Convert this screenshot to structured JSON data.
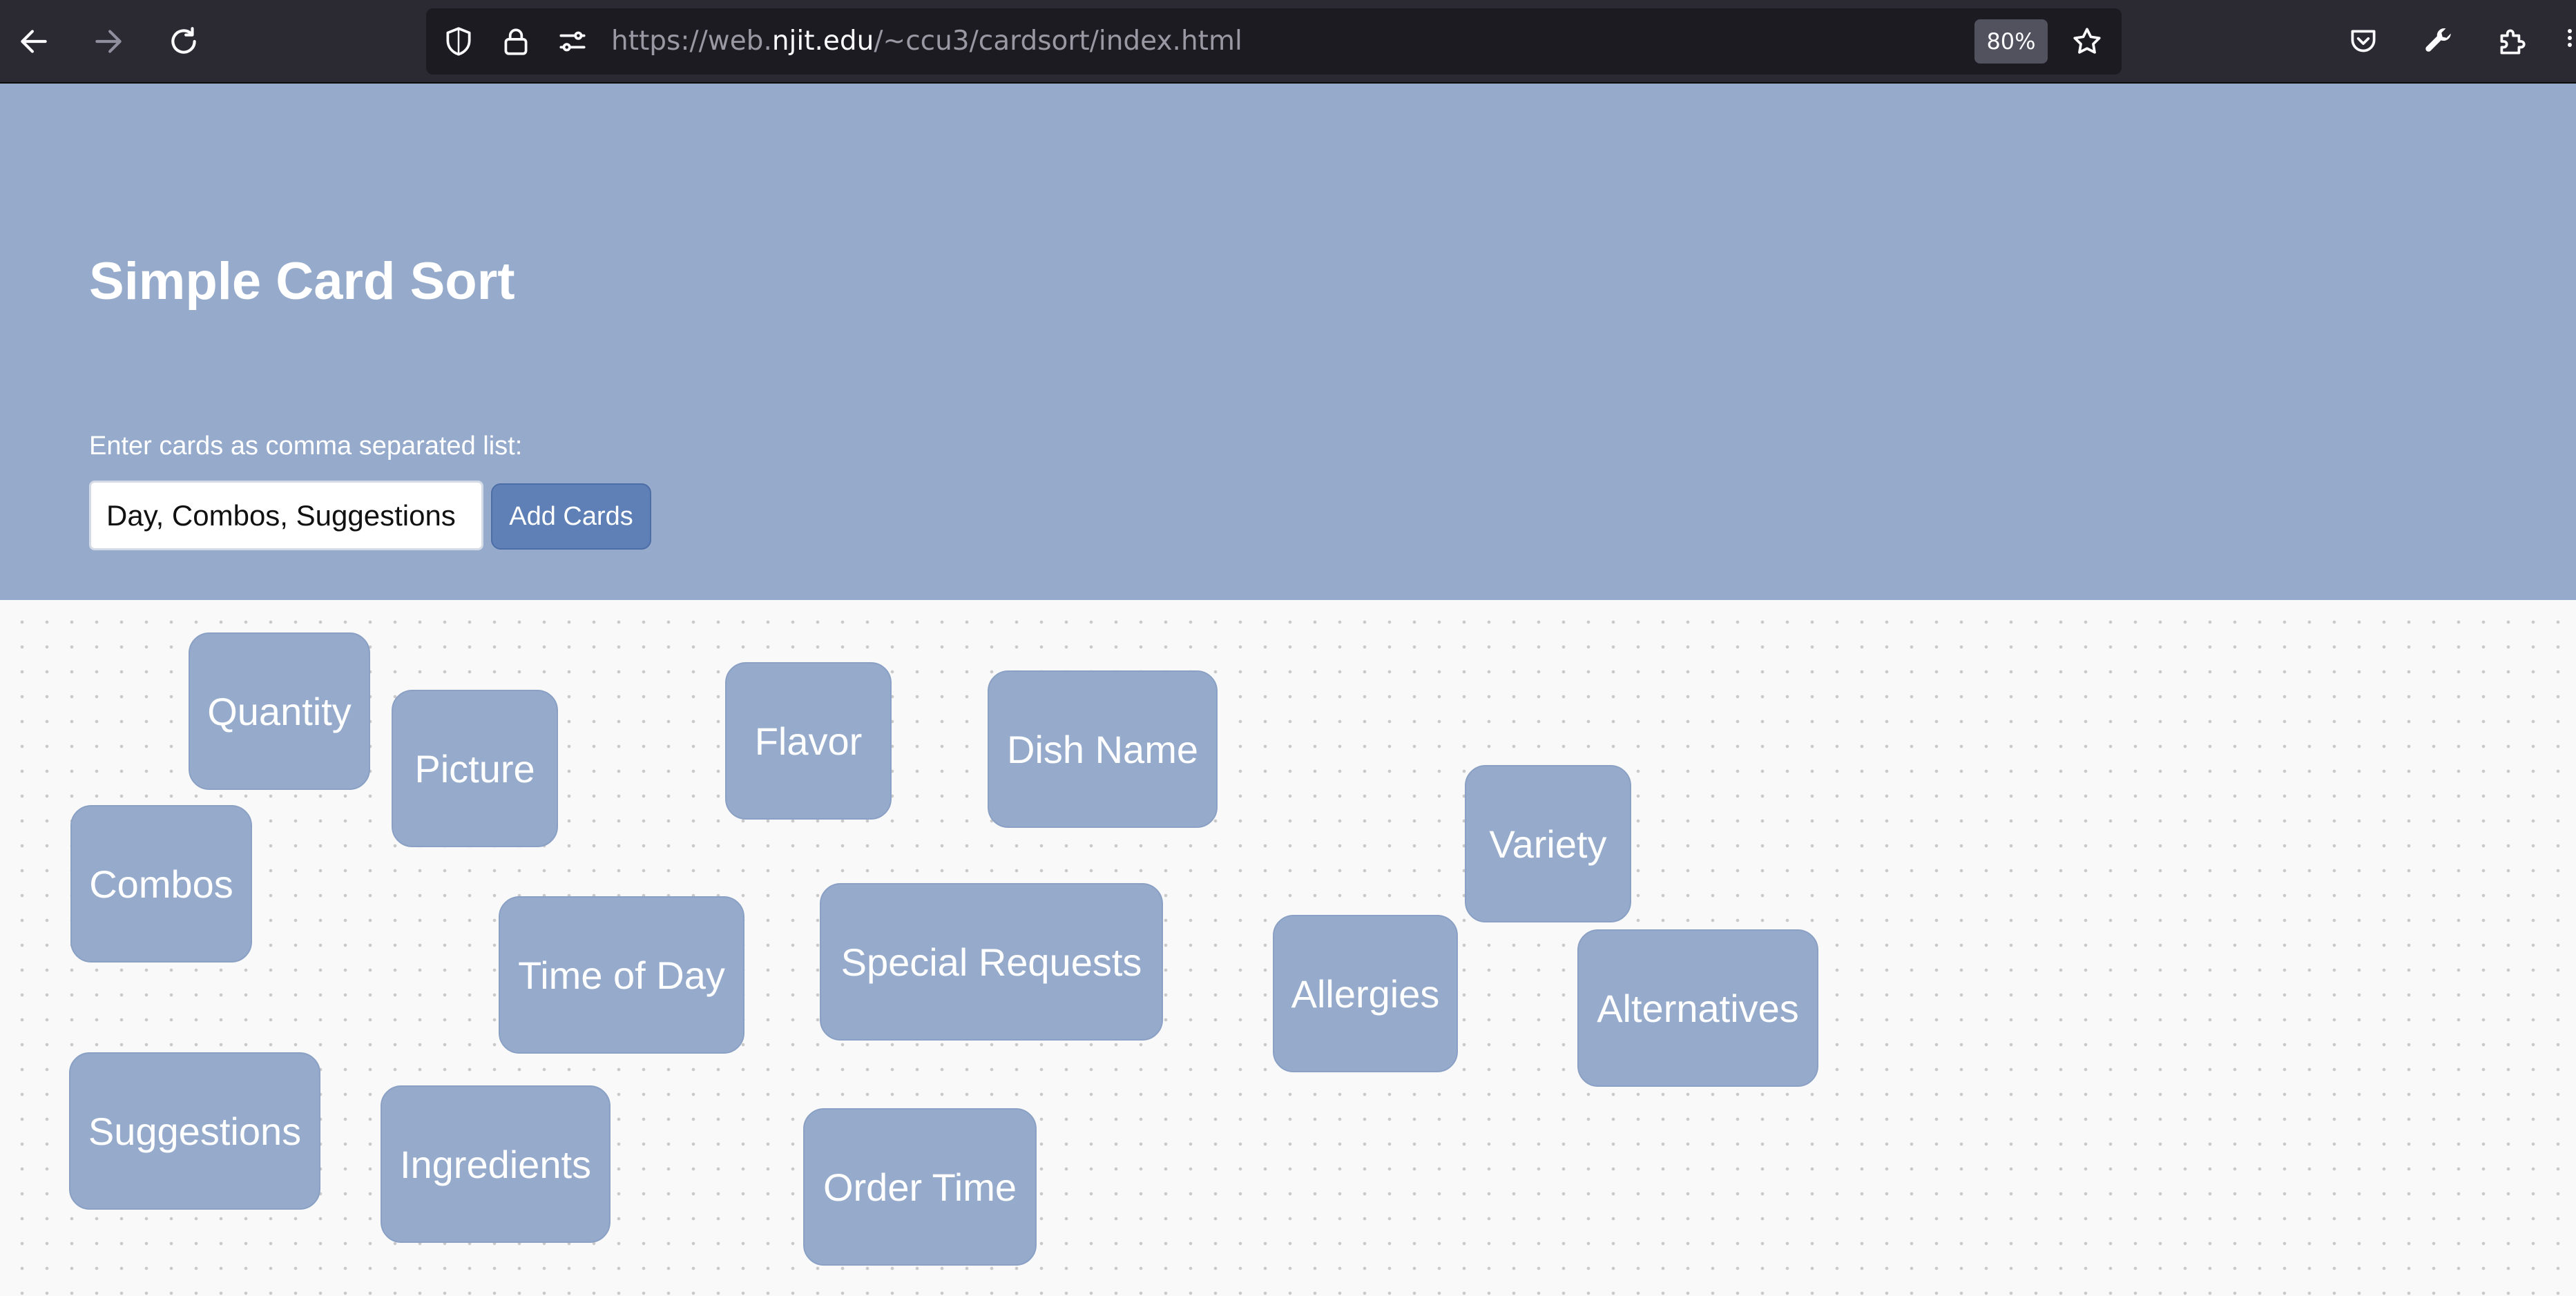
{
  "browser": {
    "url_prefix": "https://web.",
    "url_domain": "njit.edu",
    "url_path": "/~ccu3/cardsort/index.html",
    "zoom": "80%",
    "icons": {
      "back": "arrow-left-icon",
      "forward": "arrow-right-icon",
      "reload": "reload-icon",
      "tracking": "shield-icon",
      "lock": "lock-icon",
      "permissions": "permissions-icon",
      "bookmark": "star-icon",
      "pocket": "pocket-icon",
      "tools": "wrench-icon",
      "extensions": "puzzle-icon"
    },
    "colors": {
      "toolbar": "#2b2a33",
      "urlbar": "#1c1b22"
    }
  },
  "page": {
    "title": "Simple Card Sort",
    "label": "Enter cards as comma separated list:",
    "input_value": "Day, Combos, Suggestions",
    "add_button": "Add Cards",
    "colors": {
      "header": "#96abcc",
      "button": "#5f80b6",
      "card": "#96abcc",
      "board": "#f9f9f9"
    }
  },
  "cards": [
    "Quantity",
    "Picture",
    "Flavor",
    "Dish Name",
    "Combos",
    "Variety",
    "Time of Day",
    "Special Requests",
    "Allergies",
    "Alternatives",
    "Suggestions",
    "Ingredients",
    "Order Time"
  ]
}
